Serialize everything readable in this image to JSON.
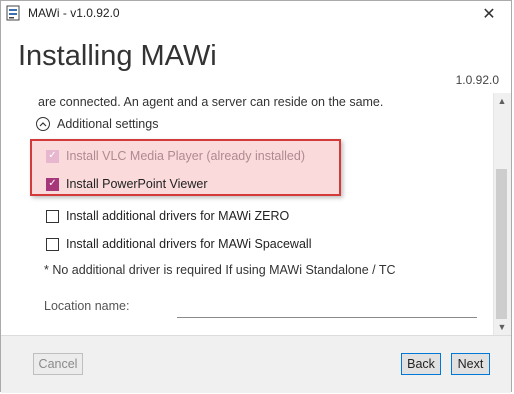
{
  "window": {
    "title": "MAWi - v1.0.92.0",
    "close_glyph": "✕"
  },
  "header": {
    "title": "Installing MAWi",
    "version": "1.0.92.0"
  },
  "content": {
    "top_line": "are connected. An agent and a server can reside on the same.",
    "additional_settings_label": "Additional settings",
    "checkboxes": [
      {
        "label": "Install VLC Media Player (already installed)",
        "checked": true,
        "disabled": true
      },
      {
        "label": "Install PowerPoint Viewer",
        "checked": true,
        "disabled": false
      },
      {
        "label": "Install additional drivers for MAWi ZERO",
        "checked": false,
        "disabled": false
      },
      {
        "label": "Install additional drivers for MAWi Spacewall",
        "checked": false,
        "disabled": false
      }
    ],
    "note": "* No additional driver is required If using MAWi Standalone / TC",
    "location_label": "Location name:",
    "location_value": "",
    "highlight_color": "#d33a3a",
    "check_color": "#a5377a"
  },
  "footer": {
    "cancel_label": "Cancel",
    "back_label": "Back",
    "next_label": "Next"
  },
  "icons": {
    "app": "app-icon",
    "scroll_up": "▲",
    "scroll_down": "▼",
    "collapse": "chevron-up-icon"
  }
}
